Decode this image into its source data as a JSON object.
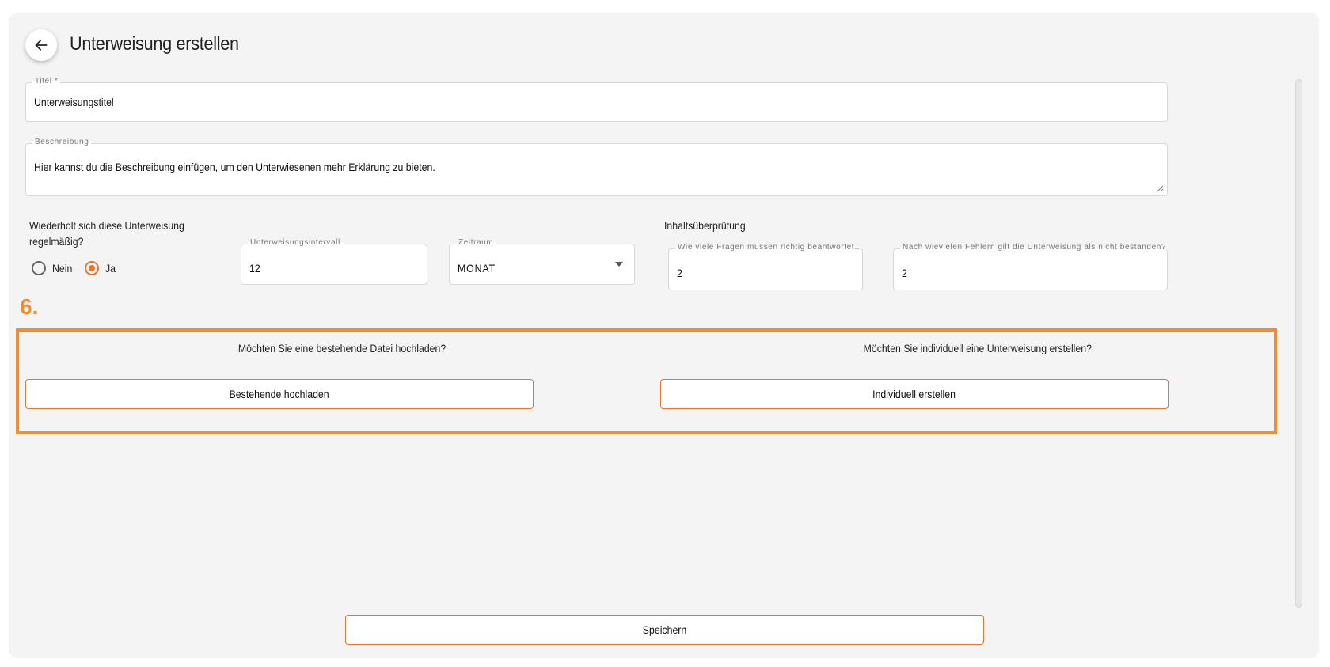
{
  "page": {
    "title": "Unterweisung erstellen",
    "back_icon": "arrow-left-icon"
  },
  "form": {
    "title_field": {
      "label": "Titel *",
      "value": "Unterweisungstitel"
    },
    "description_field": {
      "label": "Beschreibung",
      "value": "Hier kannst du die Beschreibung einfügen, um den Unterwiesenen mehr Erklärung zu bieten."
    },
    "repeat": {
      "question": "Wiederholt sich diese Unterweisung regelmäßig?",
      "options": [
        {
          "label": "Nein",
          "checked": false
        },
        {
          "label": "Ja",
          "checked": true
        }
      ]
    },
    "interval_field": {
      "label": "Unterweisungsintervall",
      "value": "12"
    },
    "period_select": {
      "label": "Zeitraum",
      "value": "MONAT"
    },
    "content_check": {
      "heading": "Inhaltsüberprüfung",
      "correct_field": {
        "label": "Wie viele Fragen müssen richtig beantwortet…",
        "value": "2"
      },
      "errors_field": {
        "label": "Nach wievielen Fehlern gilt die Unterweisung als nicht bestanden?",
        "value": "2"
      }
    }
  },
  "annotation": {
    "step": "6."
  },
  "choice": {
    "upload_question": "Möchten Sie eine bestehende Datei hochladen?",
    "upload_button": "Bestehende hochladen",
    "create_question": "Möchten Sie individuell eine Unterweisung erstellen?",
    "create_button": "Individuell erstellen"
  },
  "footer": {
    "save_button": "Speichern"
  },
  "colors": {
    "accent": "#e8742e",
    "highlight": "#f58b2e",
    "panel_bg": "#f4f4f4"
  }
}
